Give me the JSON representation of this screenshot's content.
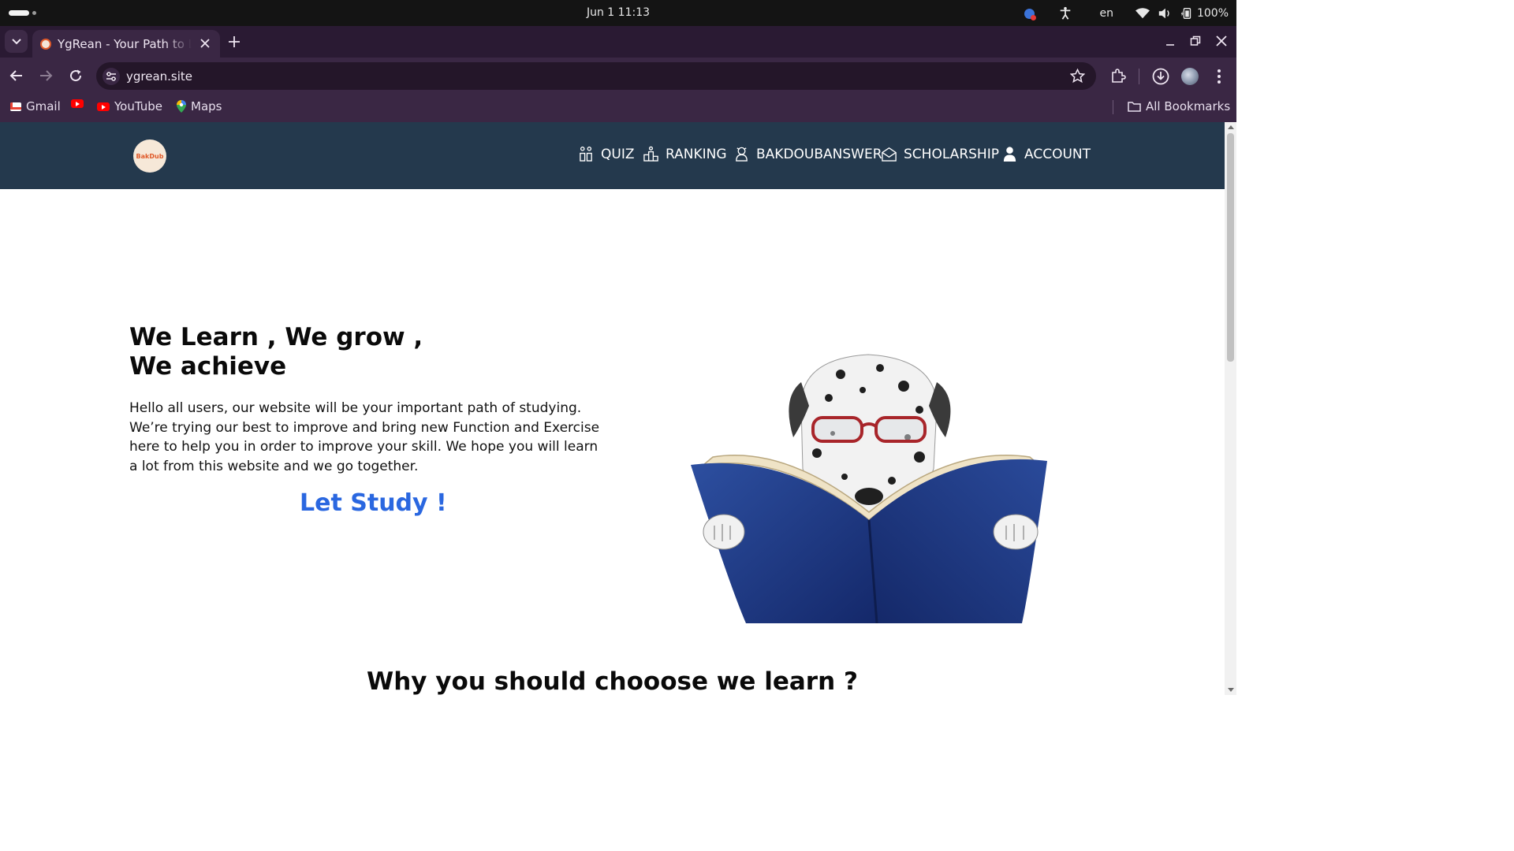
{
  "os": {
    "clock": "Jun 1  11:13",
    "language": "en",
    "battery": "100%"
  },
  "browser": {
    "tab_title": "YgRean - Your Path to Learn",
    "url": "ygrean.site",
    "bookmarks": {
      "gmail": "Gmail",
      "youtube": "YouTube",
      "maps": "Maps",
      "all": "All Bookmarks"
    }
  },
  "site": {
    "logo_text": "BakDub",
    "menu": {
      "quiz": "QUIZ",
      "ranking": "RANKING",
      "bakdoubanswer": "BAKDOUBANSWER",
      "scholarship": "SCHOLARSHIP",
      "account": "ACCOUNT"
    },
    "hero": {
      "title_line1": "We Learn , We grow ,",
      "title_line2": "We achieve",
      "body": "Hello all users, our website will be your important path of studying. We’re trying our best to improve and bring new Function and Exercise here to help you in order to improve your skill. We hope you will learn a lot from this website and we go together.",
      "cta": "Let Study !"
    },
    "section_title": "Why you should chooose we learn ?"
  },
  "colors": {
    "nav_bg": "#24394d",
    "cta": "#2a67e0",
    "tab_strip": "#2a1a33",
    "toolbar": "#3a2744"
  }
}
